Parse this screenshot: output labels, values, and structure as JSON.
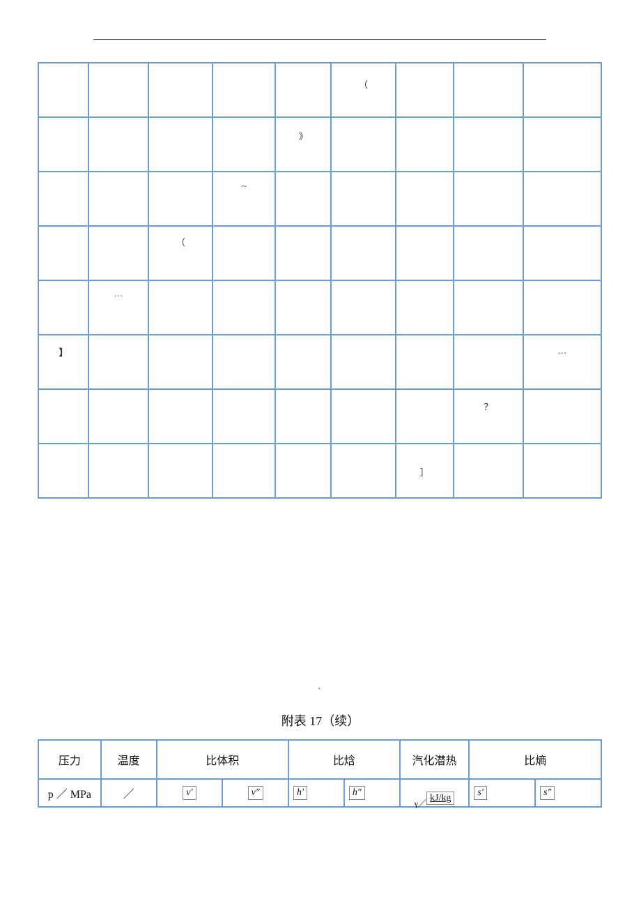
{
  "table1": {
    "rows": [
      {
        "c1": "",
        "c2": "",
        "c3": "",
        "c4": "",
        "c5": "",
        "c6": "（",
        "c7": "",
        "c8": "",
        "c9": ""
      },
      {
        "c1": "",
        "c2": "",
        "c3": "",
        "c4": "",
        "c5": "》",
        "c6": "",
        "c7": "",
        "c8": "",
        "c9": ""
      },
      {
        "c1": "",
        "c2": "",
        "c3": "",
        "c4": "~",
        "c5": "",
        "c6": "",
        "c7": "",
        "c8": "",
        "c9": ""
      },
      {
        "c1": "",
        "c2": "",
        "c3": "（",
        "c4": "",
        "c5": "",
        "c6": "",
        "c7": "",
        "c8": "",
        "c9": ""
      },
      {
        "c1": "",
        "c2": "…",
        "c3": "",
        "c4": "",
        "c5": "",
        "c6": "",
        "c7": "",
        "c8": "",
        "c9": ""
      },
      {
        "c1": "】",
        "c2": "",
        "c3": "",
        "c4": "",
        "c5": "",
        "c6": "",
        "c7": "",
        "c8": "",
        "c9": "…"
      },
      {
        "c1": "",
        "c2": "",
        "c3": "",
        "c4": "",
        "c5": "",
        "c6": "",
        "c7": "",
        "c8": "？",
        "c9": ""
      },
      {
        "c1": "",
        "c2": "",
        "c3": "",
        "c4": "",
        "c5": "",
        "c6": "",
        "c7": "］",
        "c8": "",
        "c9": ""
      }
    ]
  },
  "backtick": "`",
  "caption": "附表 17（续）",
  "table2": {
    "head": {
      "pressure": "压力",
      "temperature": "温度",
      "spec_vol": "比体积",
      "enthalpy": "比焓",
      "latent": "汽化潜热",
      "entropy": "比熵"
    },
    "sub": {
      "p": "p ／ MPa",
      "t": "／",
      "v1": "ν′",
      "v2": "ν″",
      "h1": "h′",
      "h2": "h″",
      "gamma_prefix": "γ／",
      "gamma_unit": "kJ/kg",
      "s1": "s′",
      "s2": "s″"
    }
  }
}
